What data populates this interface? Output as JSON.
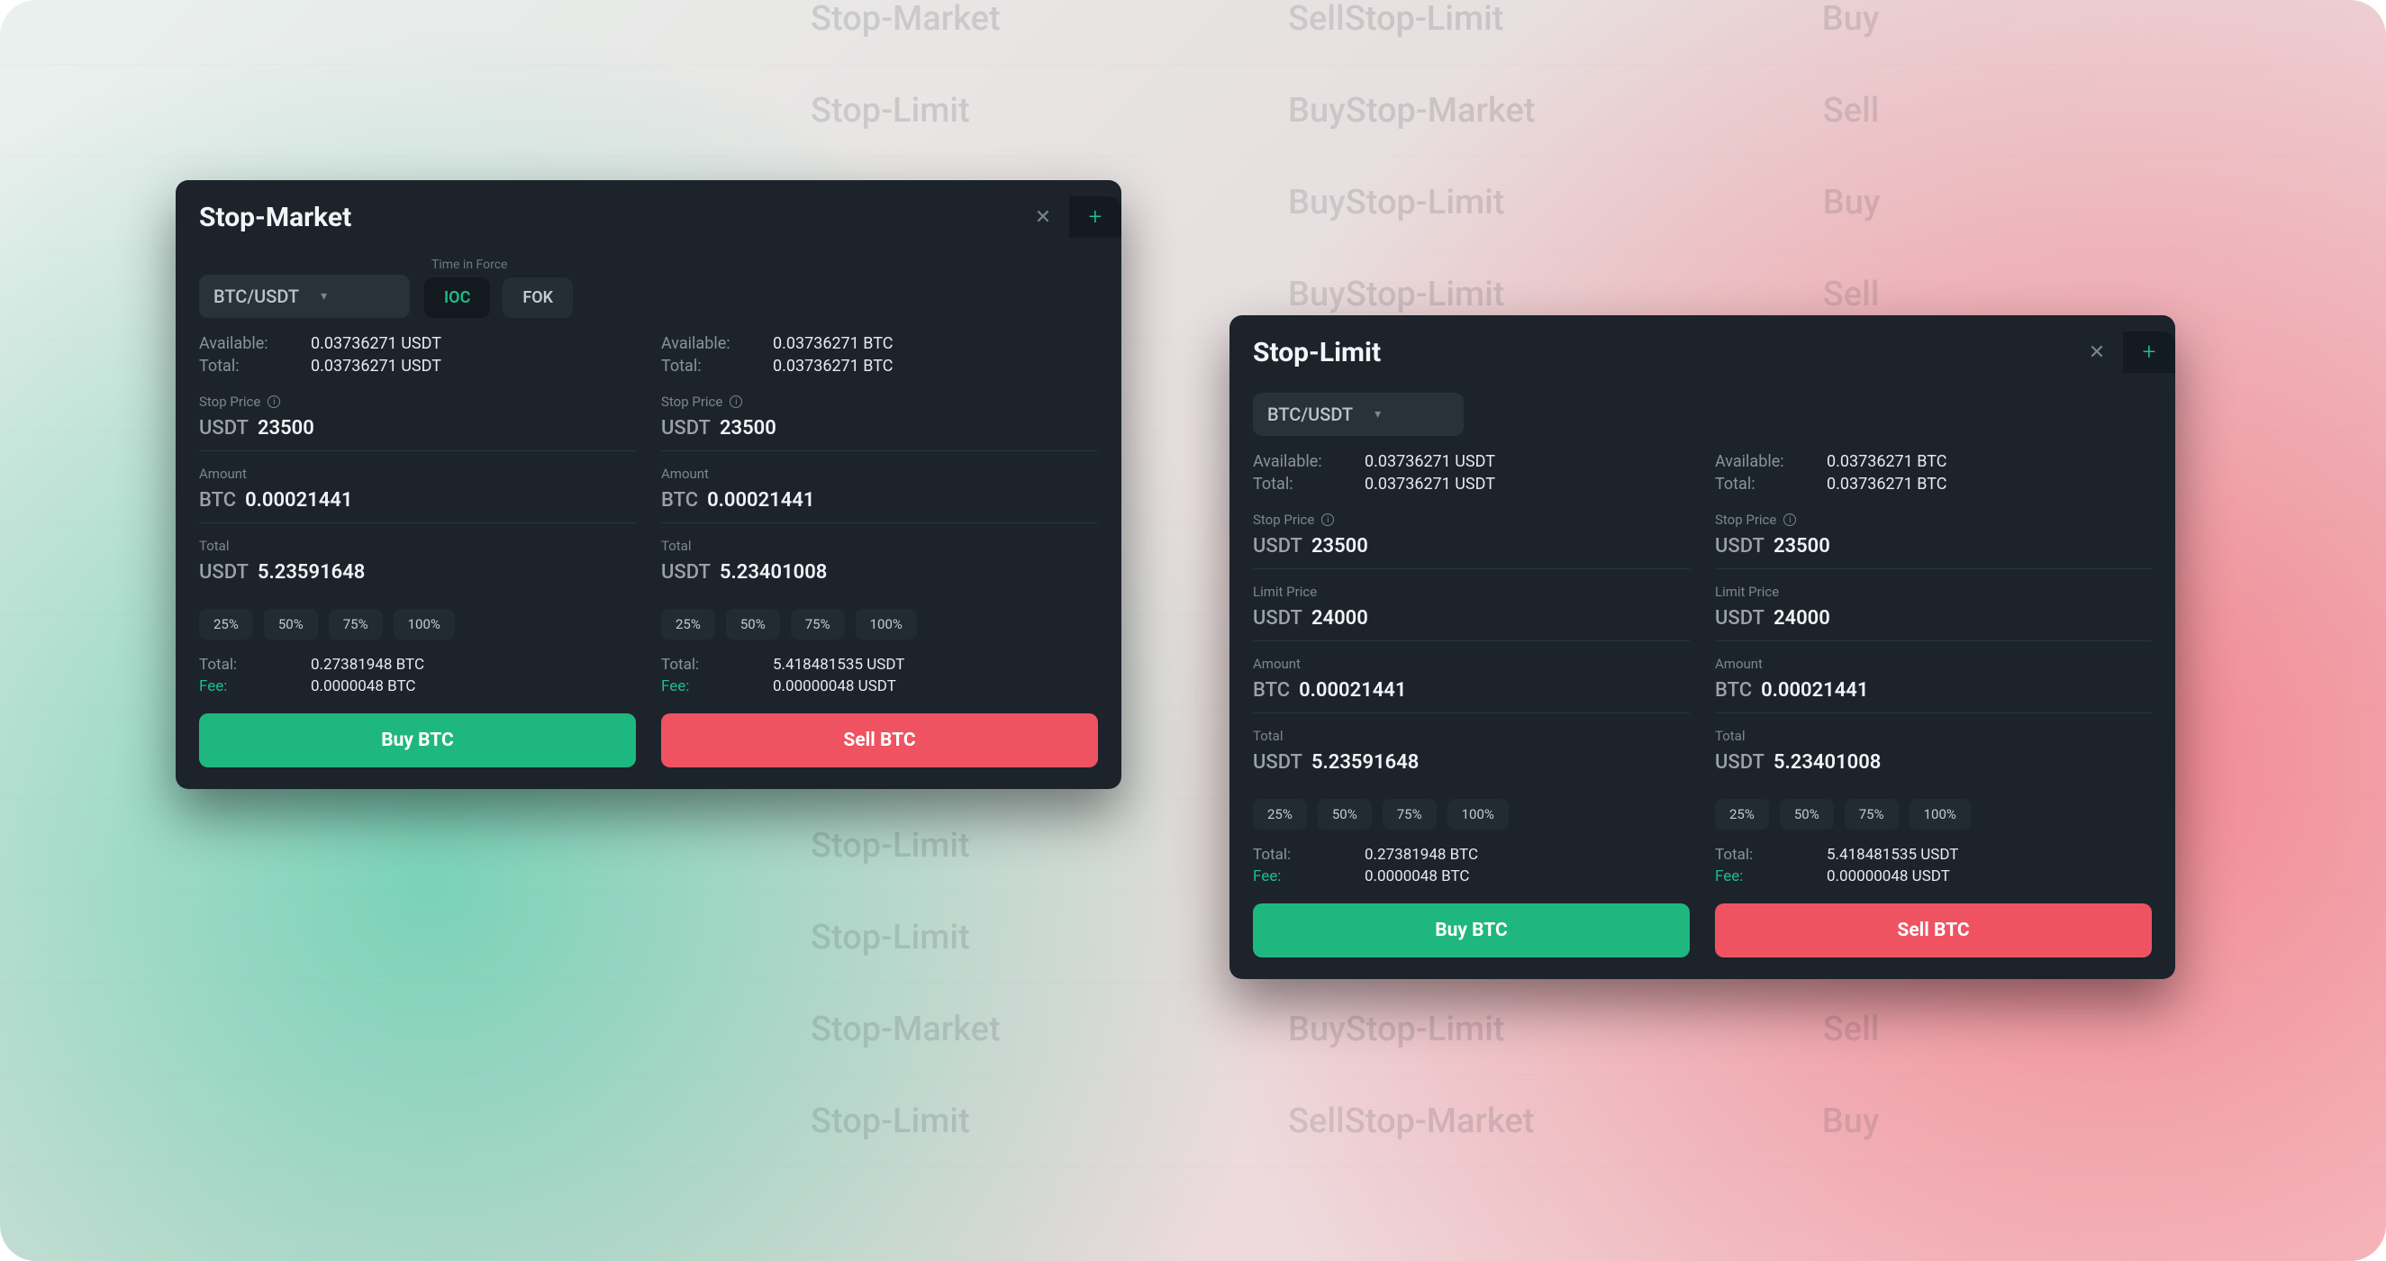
{
  "background": {
    "rows": [
      {
        "left": "Stop-Market",
        "right": "Sell",
        "side": "left"
      },
      {
        "left": "Stop-Limit",
        "right": "Buy",
        "side": "left"
      },
      {
        "left": "Stop-Limit",
        "right": "Buy",
        "side": "left"
      },
      {
        "left": "Stop-Market",
        "right": "Buy",
        "side": "left"
      },
      {
        "left": "Stop-Market",
        "right": "Sell",
        "side": "left"
      },
      {
        "left": "Stop-Market",
        "right": "Sell",
        "side": "left"
      },
      {
        "left": "Stop-Market",
        "right": "Sell",
        "side": "left"
      },
      {
        "left": "Stop-Limit",
        "right": "Buy",
        "side": "left"
      },
      {
        "left": "Stop-Limit",
        "right": "Buy",
        "side": "left"
      },
      {
        "left": "Stop-Limit",
        "right": "Sell",
        "side": "left"
      },
      {
        "left": "Stop-Limit",
        "right": "Sell",
        "side": "left"
      },
      {
        "left": "Stop-Market",
        "right": "Buy",
        "side": "left"
      },
      {
        "left": "Stop-Limit",
        "right": "Sell",
        "side": "left"
      }
    ],
    "rows_right": [
      {
        "left": "Stop-Limit",
        "right": "Buy"
      },
      {
        "left": "Stop-Market",
        "right": "Sell"
      },
      {
        "left": "Stop-Limit",
        "right": "Buy"
      },
      {
        "left": "Stop-Limit",
        "right": "Sell"
      },
      {
        "left": "Stop-Limit",
        "right": "Buy"
      },
      {
        "left": "Stop-Limit",
        "right": "Sell"
      },
      {
        "left": "Stop-Limit",
        "right": "Buy"
      },
      {
        "left": "Stop-Market",
        "right": "Sell"
      },
      {
        "left": "Stop-Limit",
        "right": "Buy"
      },
      {
        "left": "Stop-Limit",
        "right": "Sell"
      },
      {
        "left": "Stop-Market",
        "right": "Buy"
      },
      {
        "left": "Stop-Limit",
        "right": "Sell"
      },
      {
        "left": "Stop-Market",
        "right": "Buy"
      }
    ]
  },
  "colors": {
    "buy": "#1fb780",
    "sell": "#ef5362",
    "accent": "#1fbc8b"
  },
  "market": {
    "title": "Stop-Market",
    "pair": "BTC/USDT",
    "tif_caption": "Time in Force",
    "tif": {
      "ioc": "IOC",
      "fok": "FOK",
      "active": "IOC"
    },
    "labels": {
      "available": "Available:",
      "total_bal": "Total:",
      "stop_price": "Stop Price",
      "amount": "Amount",
      "total": "Total",
      "fee": "Fee:",
      "total_sum": "Total:"
    },
    "pct": [
      "25%",
      "50%",
      "75%",
      "100%"
    ],
    "buy": {
      "available": "0.03736271 USDT",
      "total_bal": "0.03736271 USDT",
      "stop_unit": "USDT",
      "stop_val": "23500",
      "amount_unit": "BTC",
      "amount_val": "0.00021441",
      "total_unit": "USDT",
      "total_val": "5.23591648",
      "summary_total": "0.27381948 BTC",
      "summary_fee": "0.0000048 BTC",
      "action": "Buy BTC"
    },
    "sell": {
      "available": "0.03736271 BTC",
      "total_bal": "0.03736271 BTC",
      "stop_unit": "USDT",
      "stop_val": "23500",
      "amount_unit": "BTC",
      "amount_val": "0.00021441",
      "total_unit": "USDT",
      "total_val": "5.23401008",
      "summary_total": "5.418481535 USDT",
      "summary_fee": "0.00000048 USDT",
      "action": "Sell BTC"
    }
  },
  "limit": {
    "title": "Stop-Limit",
    "pair": "BTC/USDT",
    "labels": {
      "available": "Available:",
      "total_bal": "Total:",
      "stop_price": "Stop Price",
      "limit_price": "Limit Price",
      "amount": "Amount",
      "total": "Total",
      "fee": "Fee:",
      "total_sum": "Total:"
    },
    "pct": [
      "25%",
      "50%",
      "75%",
      "100%"
    ],
    "buy": {
      "available": "0.03736271 USDT",
      "total_bal": "0.03736271 USDT",
      "stop_unit": "USDT",
      "stop_val": "23500",
      "limit_unit": "USDT",
      "limit_val": "24000",
      "amount_unit": "BTC",
      "amount_val": "0.00021441",
      "total_unit": "USDT",
      "total_val": "5.23591648",
      "summary_total": "0.27381948 BTC",
      "summary_fee": "0.0000048 BTC",
      "action": "Buy BTC"
    },
    "sell": {
      "available": "0.03736271 BTC",
      "total_bal": "0.03736271 BTC",
      "stop_unit": "USDT",
      "stop_val": "23500",
      "limit_unit": "USDT",
      "limit_val": "24000",
      "amount_unit": "BTC",
      "amount_val": "0.00021441",
      "total_unit": "USDT",
      "total_val": "5.23401008",
      "summary_total": "5.418481535 USDT",
      "summary_fee": "0.00000048 USDT",
      "action": "Sell BTC"
    }
  }
}
